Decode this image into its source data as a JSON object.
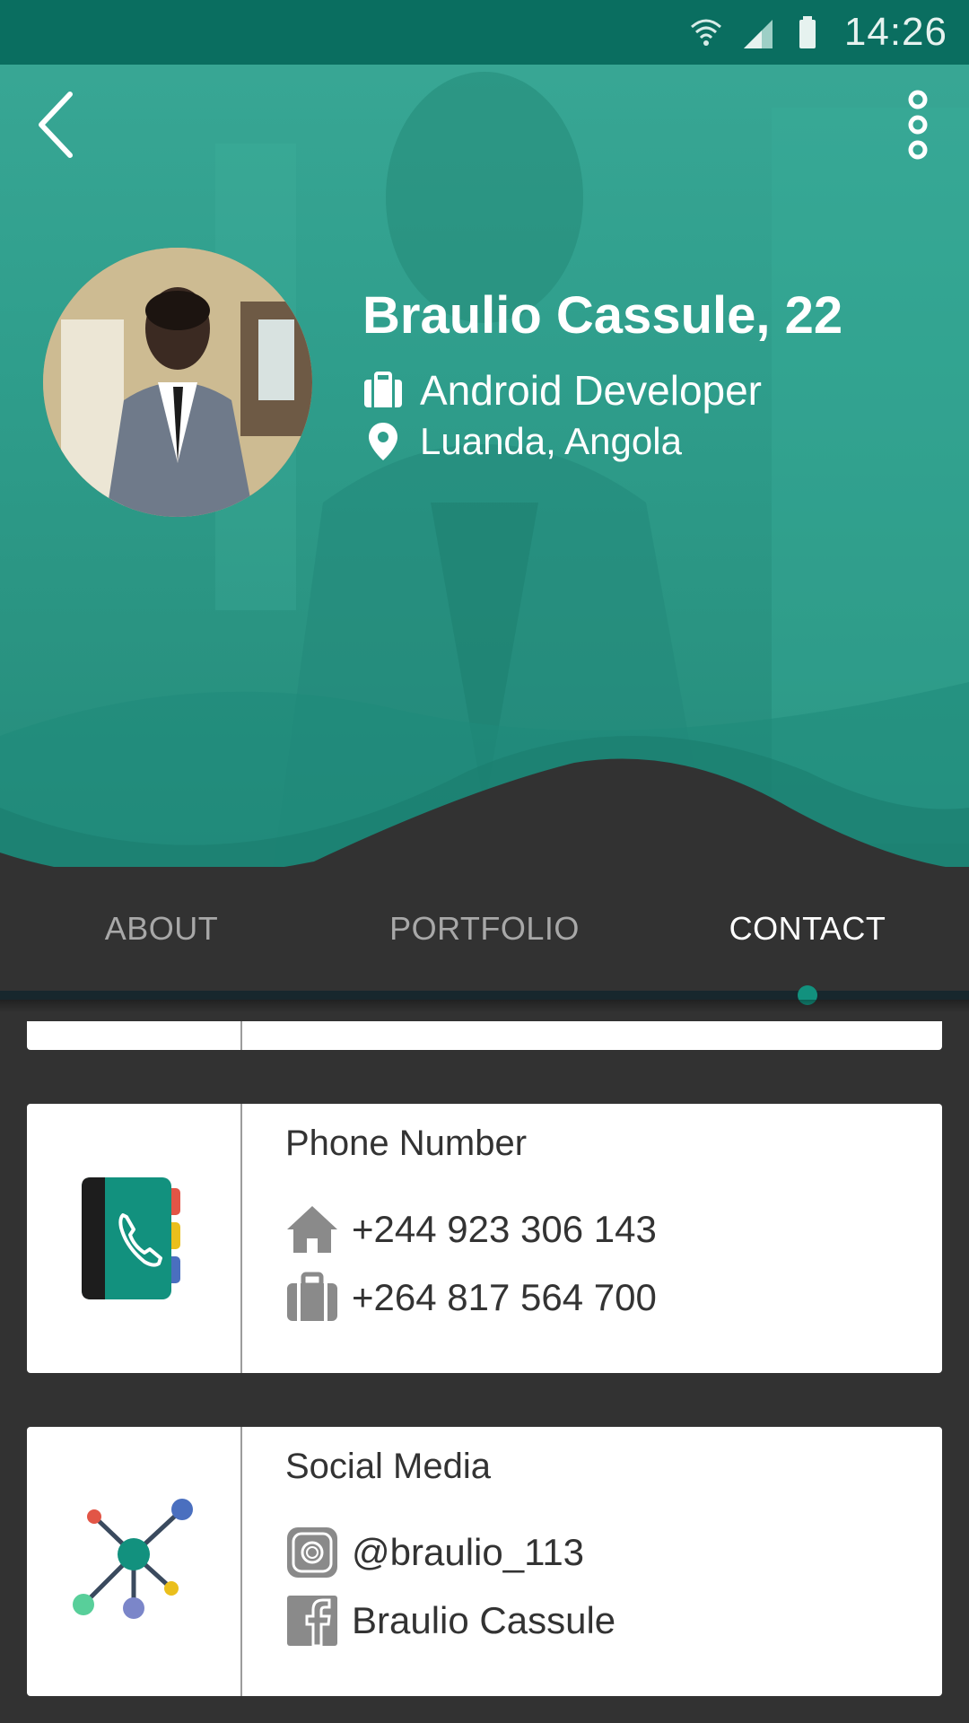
{
  "status_bar": {
    "time": "14:26",
    "icons": [
      "wifi-icon",
      "signal-icon",
      "battery-icon"
    ]
  },
  "toolbar": {
    "back_icon": "chevron-left-icon",
    "menu_icon": "more-vertical-icon"
  },
  "profile": {
    "name": "Braulio Cassule, 22",
    "job": "Android Developer",
    "job_icon": "briefcase-icon",
    "location": "Luanda, Angola",
    "location_icon": "map-pin-icon"
  },
  "tabs": [
    {
      "label": "ABOUT",
      "active": false
    },
    {
      "label": "PORTFOLIO",
      "active": false
    },
    {
      "label": "CONTACT",
      "active": true
    }
  ],
  "cards": {
    "phone": {
      "title": "Phone Number",
      "icon": "phone-book-icon",
      "rows": [
        {
          "icon": "home-icon",
          "value": "+244 923 306 143"
        },
        {
          "icon": "briefcase-icon",
          "value": "+264 817 564 700"
        }
      ]
    },
    "social": {
      "title": "Social Media",
      "icon": "network-icon",
      "rows": [
        {
          "icon": "instagram-icon",
          "value": "@braulio_113"
        },
        {
          "icon": "facebook-icon",
          "value": "Braulio Cassule"
        }
      ]
    }
  },
  "colors": {
    "accent": "#12917e",
    "status_bar": "#0a6e60",
    "background": "#323232",
    "tab_active": "#ffffff",
    "tab_inactive": "#a8a8a8"
  }
}
